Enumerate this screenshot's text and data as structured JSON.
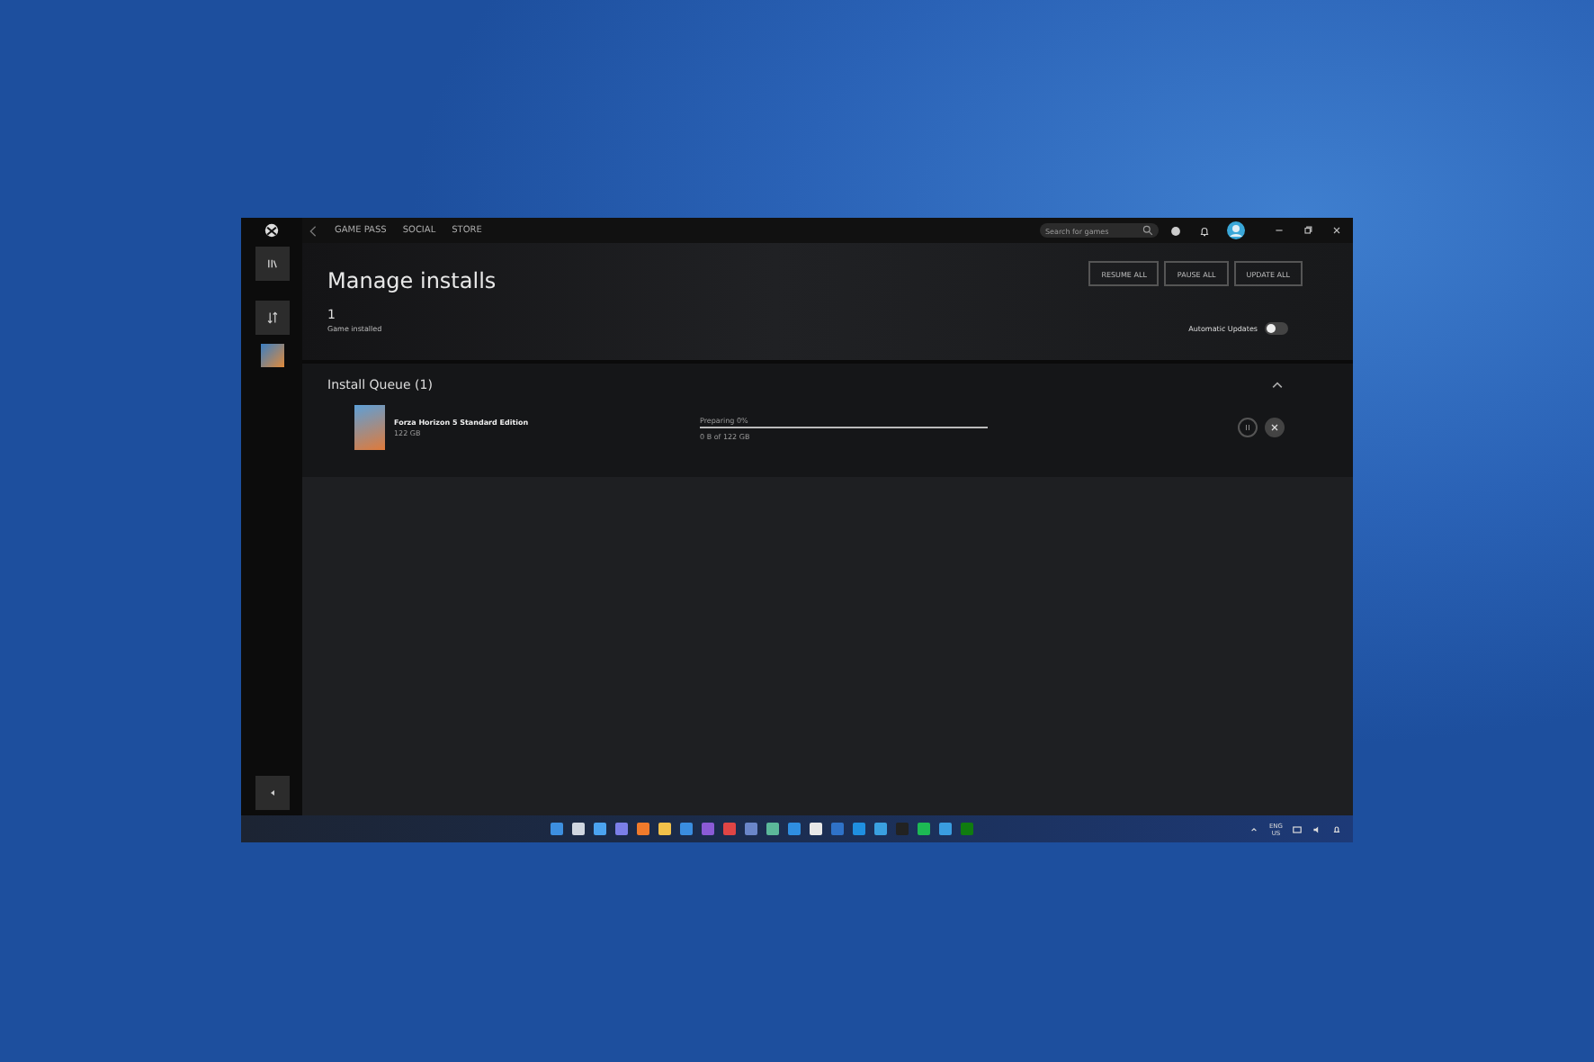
{
  "nav": {
    "tabs": [
      {
        "label": "GAME PASS",
        "selected": false
      },
      {
        "label": "SOCIAL",
        "selected": false
      },
      {
        "label": "STORE",
        "selected": false
      }
    ]
  },
  "search": {
    "placeholder": "Search for games"
  },
  "header": {
    "title": "Manage installs",
    "count": "1",
    "count_label": "Game installed",
    "buttons": [
      "RESUME ALL",
      "PAUSE ALL",
      "UPDATE ALL"
    ],
    "auto_updates": {
      "label": "Automatic Updates",
      "on": false
    }
  },
  "queue": {
    "title": "Install Queue (1)",
    "expanded": true,
    "items": [
      {
        "name": "Forza Horizon 5 Standard Edition",
        "size": "122 GB",
        "status": "Preparing 0%",
        "progress_text": "0 B of 122 GB",
        "level": 0
      }
    ]
  },
  "taskbar": {
    "language": "ENG",
    "region": "US"
  }
}
